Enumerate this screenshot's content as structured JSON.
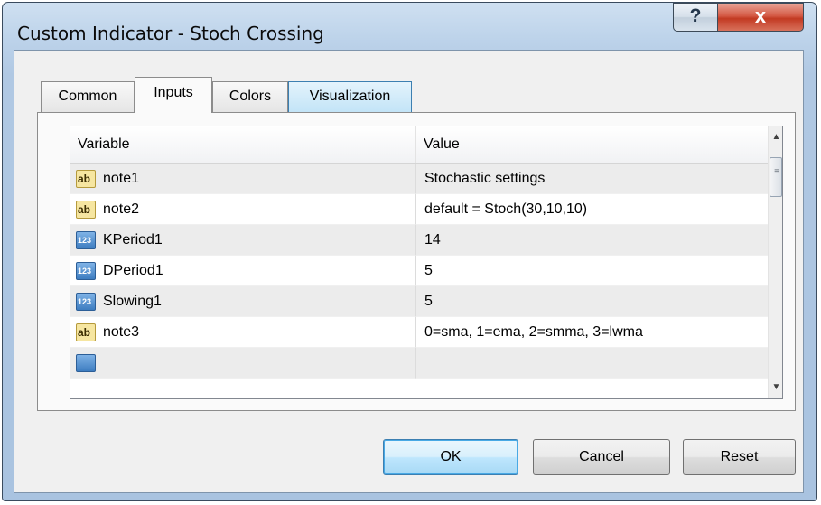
{
  "window": {
    "title": "Custom Indicator - Stoch Crossing",
    "help_glyph": "?",
    "close_glyph": "x"
  },
  "tabs": [
    {
      "label": "Common",
      "active": false
    },
    {
      "label": "Inputs",
      "active": true
    },
    {
      "label": "Colors",
      "active": false
    },
    {
      "label": "Visualization",
      "active": false
    }
  ],
  "grid": {
    "columns": [
      "Variable",
      "Value"
    ],
    "rows": [
      {
        "type_icon": "string-icon",
        "icon_text": "ab",
        "variable": "note1",
        "value": "Stochastic settings"
      },
      {
        "type_icon": "string-icon",
        "icon_text": "ab",
        "variable": "note2",
        "value": "default = Stoch(30,10,10)"
      },
      {
        "type_icon": "integer-icon",
        "icon_text": "123",
        "variable": "KPeriod1",
        "value": "14"
      },
      {
        "type_icon": "integer-icon",
        "icon_text": "123",
        "variable": "DPeriod1",
        "value": "5"
      },
      {
        "type_icon": "integer-icon",
        "icon_text": "123",
        "variable": "Slowing1",
        "value": "5"
      },
      {
        "type_icon": "string-icon",
        "icon_text": "ab",
        "variable": "note3",
        "value": "0=sma, 1=ema, 2=smma, 3=lwma"
      }
    ]
  },
  "scrollbar": {
    "up_glyph": "▲",
    "down_glyph": "▼",
    "grip_glyph": "≡"
  },
  "buttons": {
    "ok": "OK",
    "cancel": "Cancel",
    "reset": "Reset"
  }
}
